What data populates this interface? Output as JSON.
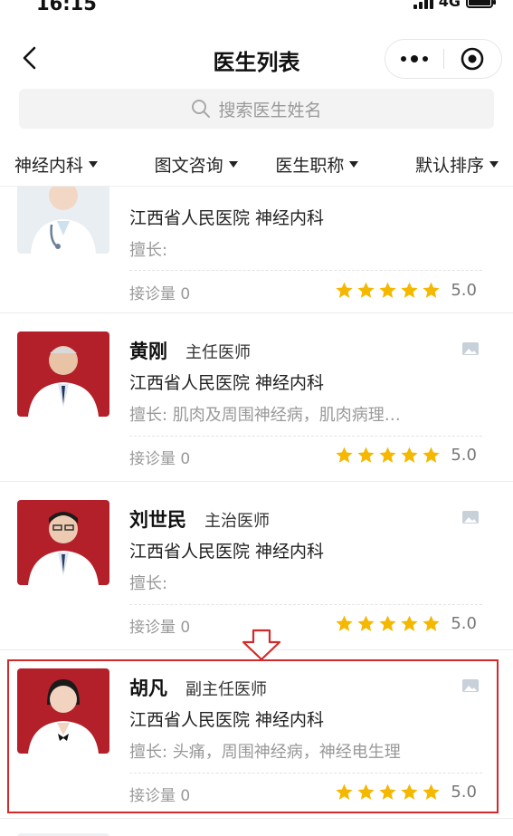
{
  "status_bar": {
    "time": "16:15",
    "network": "4G"
  },
  "nav": {
    "title": "医生列表",
    "back_icon": "chevron-left-icon",
    "more_icon": "more-dots-icon",
    "close_icon": "target-circle-icon"
  },
  "search": {
    "placeholder": "搜索医生姓名",
    "icon": "search-icon"
  },
  "filters": [
    {
      "label": "神经内科"
    },
    {
      "label": "图文咨询"
    },
    {
      "label": "医生职称"
    },
    {
      "label": "默认排序"
    }
  ],
  "doctors": [
    {
      "name": "",
      "title": "",
      "hospital": "江西省人民医院 神经内科",
      "specialty": "擅长:",
      "visits_label": "接诊量 0",
      "rating": "5.0",
      "stars": 5,
      "highlighted": false
    },
    {
      "name": "黄刚",
      "title": "主任医师",
      "hospital": "江西省人民医院 神经内科",
      "specialty": "擅长: 肌肉及周围神经病，肌肉病理…",
      "visits_label": "接诊量 0",
      "rating": "5.0",
      "stars": 5,
      "highlighted": false
    },
    {
      "name": "刘世民",
      "title": "主治医师",
      "hospital": "江西省人民医院 神经内科",
      "specialty": "擅长:",
      "visits_label": "接诊量 0",
      "rating": "5.0",
      "stars": 5,
      "highlighted": false
    },
    {
      "name": "胡凡",
      "title": "副主任医师",
      "hospital": "江西省人民医院 神经内科",
      "specialty": "擅长: 头痛，周围神经病，神经电生理",
      "visits_label": "接诊量 0",
      "rating": "5.0",
      "stars": 5,
      "highlighted": true
    }
  ],
  "colors": {
    "star": "#f5b800",
    "highlight": "#d22a2a",
    "photo_bg_red": "#b3202a",
    "photo_bg_light": "#e9eef3"
  }
}
